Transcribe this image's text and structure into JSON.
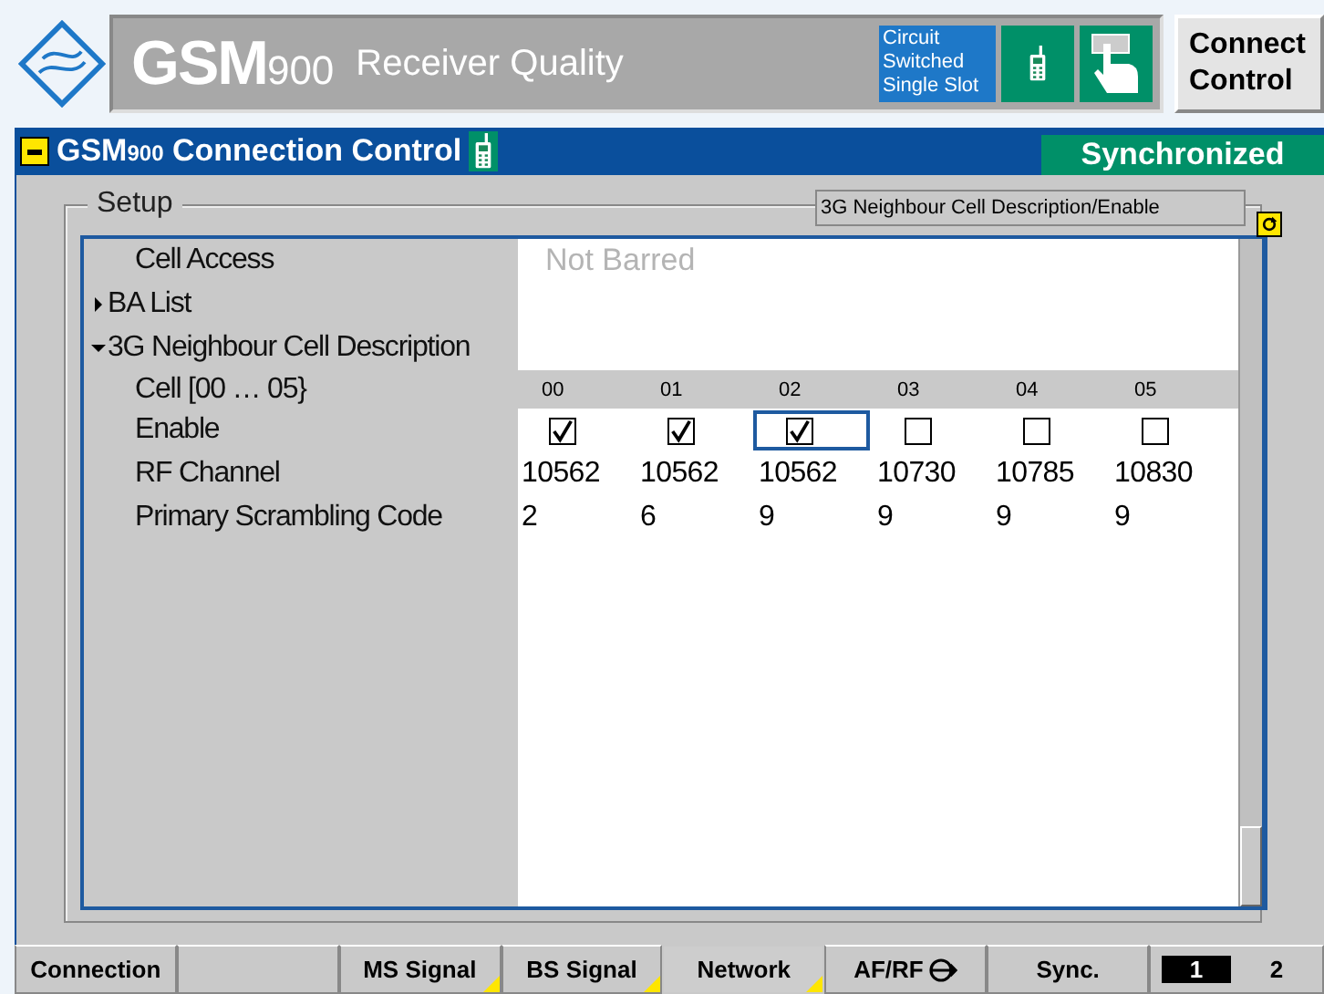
{
  "header": {
    "title": "GSM",
    "title_band": "900",
    "subtitle": "Receiver Quality",
    "mode": "Circuit Switched Single Slot",
    "connect_button": "Connect Control"
  },
  "connection_bar": {
    "title": "GSM",
    "title_band": "900",
    "label": "Connection Control",
    "status": "Synchronized"
  },
  "setup": {
    "legend": "Setup",
    "hint": "3G Neighbour Cell Description/Enable",
    "items": [
      {
        "kind": "value",
        "label": "Cell Access",
        "value": "Not Barred",
        "disabled": true
      },
      {
        "kind": "group",
        "label": "BA List",
        "expanded": false
      },
      {
        "kind": "group",
        "label": "3G Neighbour Cell Description",
        "expanded": true
      }
    ],
    "cells": {
      "label": "Cell [00 … 05}",
      "columns": [
        "00",
        "01",
        "02",
        "03",
        "04",
        "05"
      ]
    },
    "enable": {
      "label": "Enable",
      "values": [
        {
          "checked": true,
          "selected": false
        },
        {
          "checked": true,
          "selected": false
        },
        {
          "checked": true,
          "selected": true
        },
        {
          "checked": false,
          "selected": false
        },
        {
          "checked": false,
          "selected": false
        },
        {
          "checked": false,
          "selected": false
        }
      ]
    },
    "rf_channel": {
      "label": "RF Channel",
      "values": [
        "10562",
        "10562",
        "10562",
        "10730",
        "10785",
        "10830"
      ]
    },
    "scrambling_code": {
      "label": "Primary Scrambling Code",
      "values": [
        "2",
        "6",
        "9",
        "9",
        "9",
        "9"
      ]
    }
  },
  "tabs": [
    {
      "kind": "text",
      "label": "Connection",
      "selected": false,
      "flagged": false
    },
    {
      "kind": "blank",
      "selected": false,
      "flagged": false
    },
    {
      "kind": "text",
      "label": "MS Signal",
      "selected": false,
      "flagged": true
    },
    {
      "kind": "text",
      "label": "BS Signal",
      "selected": false,
      "flagged": true
    },
    {
      "kind": "text",
      "label": "Network",
      "selected": true,
      "flagged": true
    },
    {
      "kind": "text_icon",
      "label": "AF/RF",
      "selected": false,
      "flagged": false
    },
    {
      "kind": "text",
      "label": "Sync.",
      "selected": false,
      "flagged": false
    }
  ],
  "pages": [
    {
      "label": "1",
      "selected": true
    },
    {
      "label": "2",
      "selected": false
    }
  ]
}
